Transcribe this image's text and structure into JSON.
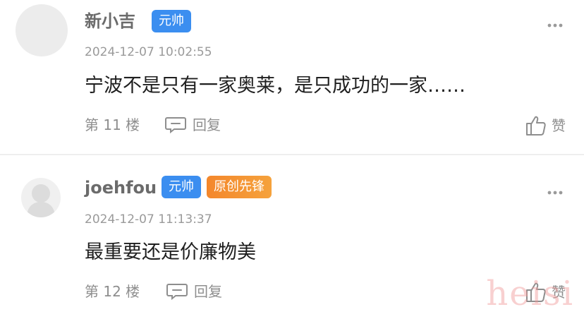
{
  "colors": {
    "badge_blue": "#3b8ef0",
    "badge_orange": "#f4872c",
    "text_muted": "#8e8e8e",
    "username": "#6b6b6b"
  },
  "comments": [
    {
      "username": "新小吉",
      "badges": [
        "元帅"
      ],
      "timestamp": "2024-12-07 10:02:55",
      "content": "宁波不是只有一家奥莱，是只成功的一家……",
      "floor": "第 11 楼",
      "reply_label": "回复",
      "like_label": "赞",
      "avatar": "blank-avatar"
    },
    {
      "username": "joehfou",
      "badges": [
        "元帅",
        "原创先锋"
      ],
      "timestamp": "2024-12-07 11:13:37",
      "content": "最重要还是价廉物美",
      "floor": "第 12 楼",
      "reply_label": "回复",
      "like_label": "赞",
      "avatar": "default-user-avatar"
    }
  ],
  "icons": {
    "reply": "comment-bubble-icon",
    "like": "thumbs-up-icon",
    "more": "more-dots-icon"
  },
  "watermark": "heisi"
}
